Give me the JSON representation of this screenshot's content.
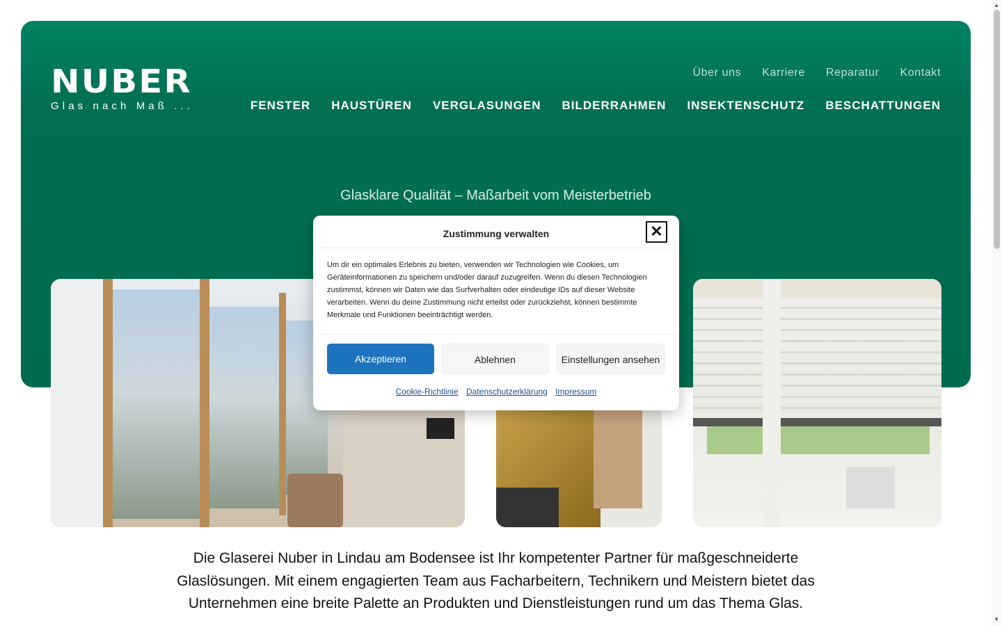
{
  "brand": {
    "name": "NUBER",
    "tagline": "Glas nach Maß ..."
  },
  "top_nav": [
    "Über uns",
    "Karriere",
    "Reparatur",
    "Kontakt"
  ],
  "main_nav": [
    "FENSTER",
    "HAUSTÜREN",
    "VERGLASUNGEN",
    "BILDERRAHMEN",
    "INSEKTENSCHUTZ",
    "BESCHATTUNGEN"
  ],
  "hero": {
    "tagline": "Glasklare Qualität – Maßarbeit vom Meisterbetrieb"
  },
  "consent_dialog": {
    "title": "Zustimmung verwalten",
    "close_symbol": "✕",
    "text": "Um dir ein optimales Erlebnis zu bieten, verwenden wir Technologien wie Cookies, um Geräteinformationen zu speichern und/oder darauf zuzugreifen. Wenn du diesen Technologien zustimmst, können wir Daten wie das Surfverhalten oder eindeutige IDs auf dieser Website verarbeiten. Wenn du deine Zustimmung nicht erteilst oder zurückziehst, können bestimmte Merkmale und Funktionen beeinträchtigt werden.",
    "accept_label": "Akzeptieren",
    "deny_label": "Ablehnen",
    "settings_label": "Einstellungen ansehen",
    "links": [
      "Cookie-Richtlinie",
      "Datenschutzerklärung",
      "Impressum"
    ]
  },
  "intro_text": "Die Glaserei Nuber in Lindau am Bodensee ist Ihr kompetenter Partner für maßgeschneiderte Glaslösungen. Mit einem engagierten Team aus Facharbeitern, Technikern und Meistern bietet das Unternehmen eine breite Palette an Produkten und Dienstleistungen rund um das Thema Glas.",
  "colors": {
    "hero_green": "#006b4f",
    "accent_blue": "#1e73be"
  },
  "icons": {
    "close": "close-icon",
    "scroll_up": "arrow-up-icon",
    "scroll_down": "arrow-down-icon"
  }
}
